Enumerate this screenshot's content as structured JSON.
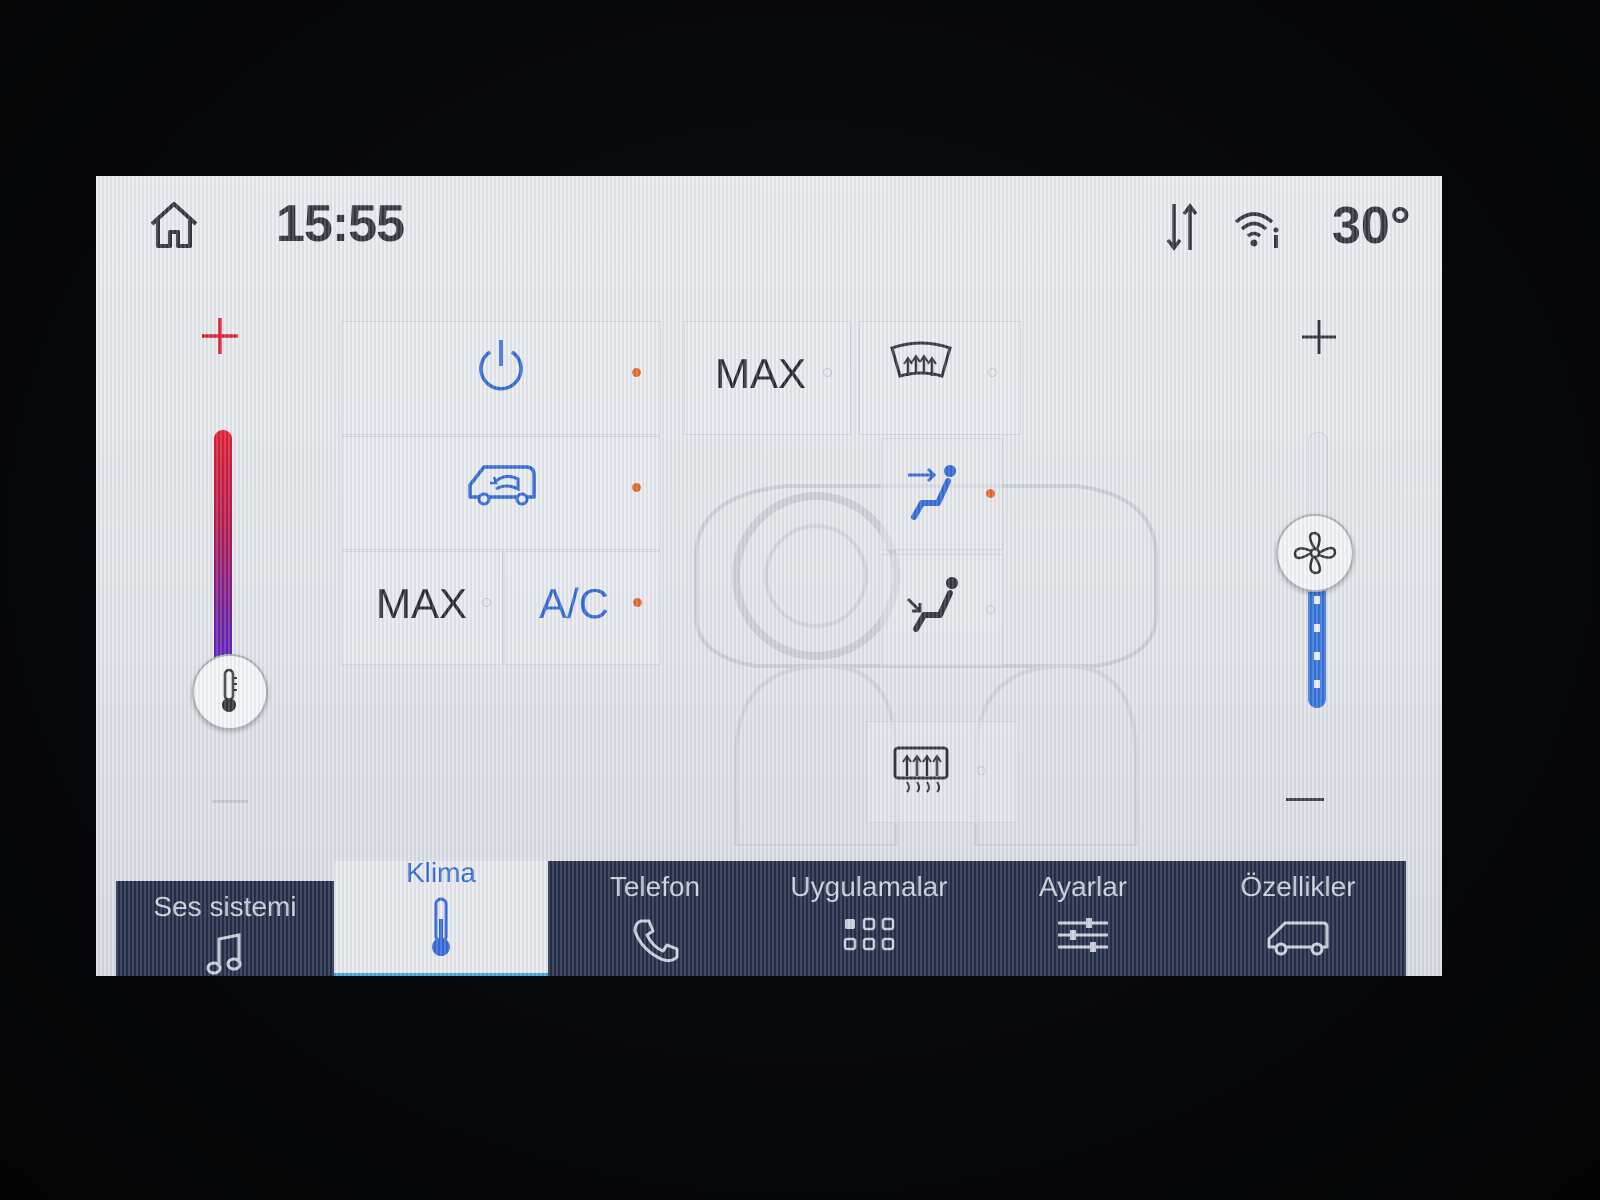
{
  "status_bar": {
    "time": "15:55",
    "outside_temperature": "30°"
  },
  "climate": {
    "temperature_plus": "+",
    "fan_plus": "+",
    "buttons": {
      "max_defrost_label": "MAX",
      "max_ac_label": "MAX",
      "ac_label": "A/C"
    },
    "colors": {
      "accent_blue": "#2a63d4",
      "indicator_on": "#e0661c",
      "temp_hot": "#e0162a",
      "temp_cold": "#5a20c0"
    }
  },
  "nav": {
    "items": [
      {
        "label": "Ses sistemi",
        "icon": "music-note-icon"
      },
      {
        "label": "Klima",
        "icon": "thermometer-icon",
        "active": true
      },
      {
        "label": "Telefon",
        "icon": "phone-icon"
      },
      {
        "label": "Uygulamalar",
        "icon": "apps-grid-icon"
      },
      {
        "label": "Ayarlar",
        "icon": "sliders-icon"
      },
      {
        "label": "Özellikler",
        "icon": "van-icon"
      }
    ]
  }
}
